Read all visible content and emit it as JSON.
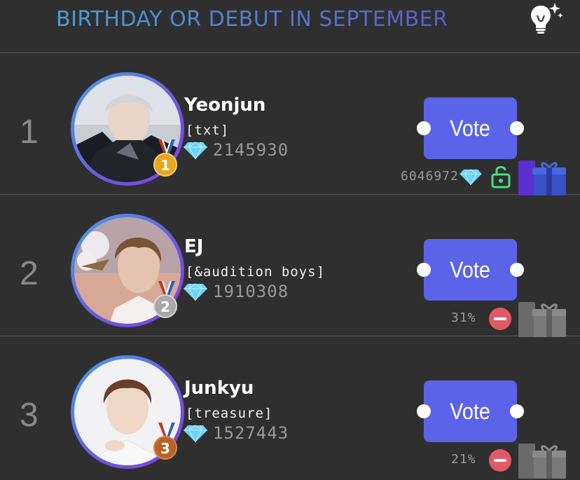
{
  "header": {
    "title": "BIRTHDAY OR DEBUT IN SEPTEMBER",
    "icon": "lightbulb-sparkle-icon"
  },
  "colors": {
    "background": "#2f2f2f",
    "vote_button": "#5b63e8",
    "title_gradient_start": "#4aa0d8",
    "title_gradient_end": "#5a5ccc",
    "gift_active": "#5b3ad8",
    "gift_inactive": "#7a7a7a",
    "lock": "#4ade80",
    "minus": "#e05a66"
  },
  "ranking": [
    {
      "rank": "1",
      "name": "Yeonjun",
      "group": "[txt]",
      "score": "2145930",
      "medal": "1",
      "medal_type": "gold",
      "vote_label": "Vote",
      "stat": "6046972",
      "stat_icon": "diamond-icon",
      "status_icon": "lock-open-icon",
      "gift_state": "active"
    },
    {
      "rank": "2",
      "name": "EJ",
      "group": "[&audition boys]",
      "score": "1910308",
      "medal": "2",
      "medal_type": "silver",
      "vote_label": "Vote",
      "stat": "31%",
      "status_icon": "minus-circle-icon",
      "gift_state": "inactive"
    },
    {
      "rank": "3",
      "name": "Junkyu",
      "group": "[treasure]",
      "score": "1527443",
      "medal": "3",
      "medal_type": "bronze",
      "vote_label": "Vote",
      "stat": "21%",
      "status_icon": "minus-circle-icon",
      "gift_state": "inactive"
    }
  ]
}
